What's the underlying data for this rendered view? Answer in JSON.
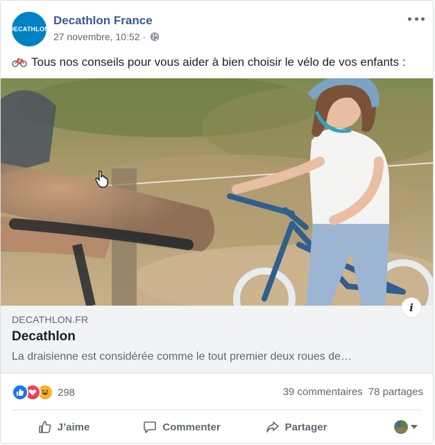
{
  "post": {
    "page_name": "Decathlon France",
    "avatar_text": "DECATHLON",
    "timestamp": "27 novembre, 10:52 ·",
    "text": "Tous nos conseils pour vous aider à bien choisir le vélo de vos enfants :"
  },
  "link_preview": {
    "domain": "DECATHLON.FR",
    "title": "Decathlon",
    "description": "La draisienne est considérée comme le tout premier deux roues de…",
    "info_label": "i"
  },
  "stats": {
    "reaction_count": "298",
    "comments": "39 commentaires",
    "shares": "78 partages"
  },
  "actions": {
    "like": "J’aime",
    "comment": "Commenter",
    "share": "Partager"
  },
  "colors": {
    "brand_blue": "#0082c3",
    "link_blue": "#385898",
    "like_blue": "#1877f2",
    "love_red": "#f33e58",
    "haha_yellow": "#f7b125"
  },
  "icons": [
    "globe-icon",
    "more-icon",
    "bicycle-icon",
    "cursor-icon",
    "like-icon",
    "love-icon",
    "haha-icon",
    "thumbs-up-icon",
    "comment-icon",
    "share-icon",
    "chevron-down-icon"
  ]
}
